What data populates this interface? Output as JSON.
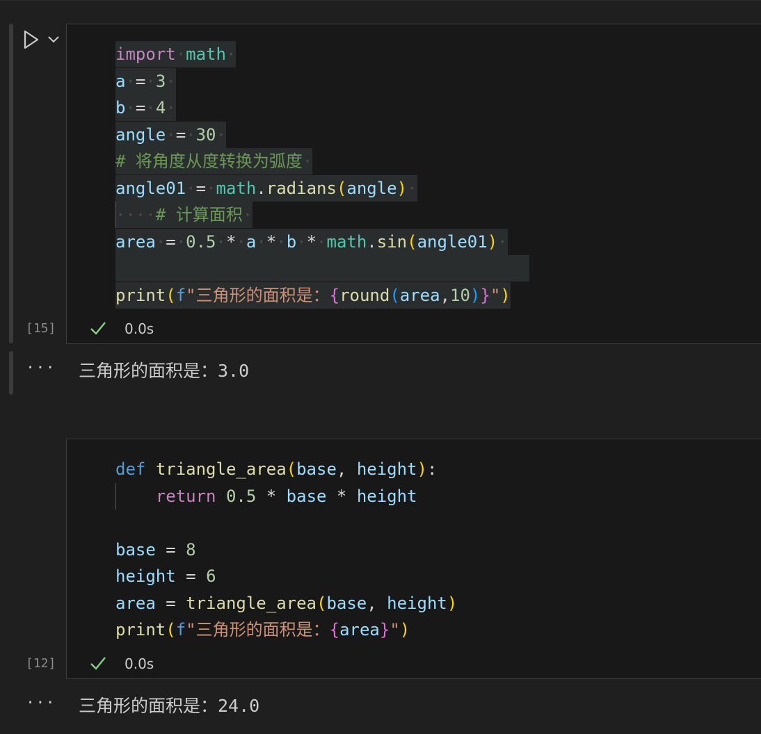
{
  "cells": [
    {
      "execution_count": "[15]",
      "status_time": "0.0s",
      "output_prefix": "···",
      "output_text": "三角形的面积是：3.0"
    },
    {
      "execution_count": "[12]",
      "status_time": "0.0s",
      "output_prefix": "···",
      "output_text": "三角形的面积是：24.0"
    }
  ],
  "icons": {
    "run": "play-icon",
    "run_menu": "chevron-down-icon",
    "status": "check-icon"
  },
  "colors": {
    "keyword": "#c586c0",
    "module": "#4ec9b0",
    "variable": "#9cdcfe",
    "number": "#b5cea8",
    "function": "#dcdcaa",
    "string": "#ce9178",
    "comment": "#6a9955",
    "success": "#89d185"
  }
}
